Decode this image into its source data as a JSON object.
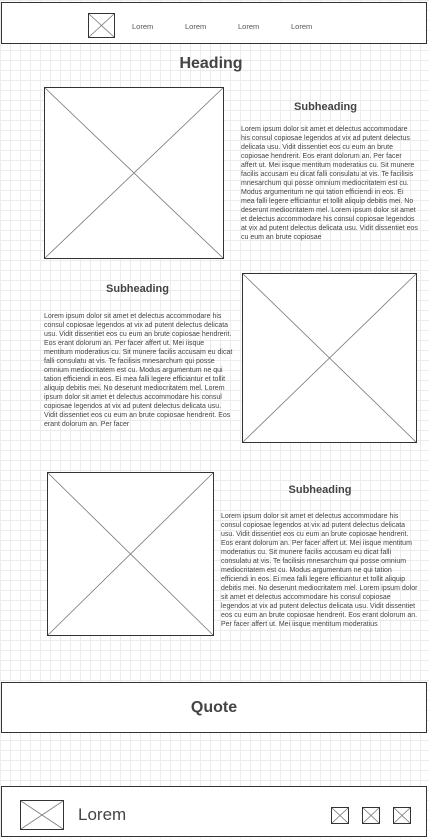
{
  "header": {
    "nav": [
      "Lorem",
      "Lorem",
      "Lorem",
      "Lorem"
    ]
  },
  "main": {
    "heading": "Heading",
    "sections": [
      {
        "subheading": "Subheading",
        "body": "Lorem ipsum dolor sit amet et delectus accommodare his consul copiosae legendos at vix ad putent delectus delicata usu. Vidit dissentiet eos cu eum an brute copiosae hendrerit. Eos erant dolorum an. Per facer affert ut. Mei iisque mentitum moderatius cu. Sit munere facilis accusam eu dicat falli consulatu at vis. Te facilisis mnesarchum qui posse omnium mediocritatem est cu. Modus argumentum ne qui tation efficiendi in eos. Ei mea falli legere efficiantur et tollit aliquip debitis mei. No deserunt mediocritatem mel. Lorem ipsum dolor sit amet et delectus accommodare his consul copiosae legendos at vix ad putent delectus delicata usu. Vidit dissentiet eos cu eum an brute copiosae"
      },
      {
        "subheading": "Subheading",
        "body": "Lorem ipsum dolor sit amet et delectus accommodare his consul copiosae legendos at vix ad putent delectus delicata usu. Vidit dissentiet eos cu eum an brute copiosae hendrerit. Eos erant dolorum an. Per facer affert ut. Mei iisque mentitum moderatius cu. Sit munere facilis accusam eu dicat falli consulatu at vis. Te facilisis mnesarchum qui posse omnium mediocritatem est cu. Modus argumentum ne qui tation efficiendi in eos. Ei mea falli legere efficiantur et tollit aliquip debitis mei. No deserunt mediocritatem mel. Lorem ipsum dolor sit amet et delectus accommodare his consul copiosae legendos at vix ad putent delectus delicata usu. Vidit dissentiet eos cu eum an brute copiosae hendrerit. Eos erant dolorum an. Per facer"
      },
      {
        "subheading": "Subheading",
        "body": "Lorem ipsum dolor sit amet et delectus accommodare his consul copiosae legendos at vix ad putent delectus delicata usu. Vidit dissentiet eos cu eum an brute copiosae hendrerit. Eos erant dolorum an. Per facer affert ut. Mei iisque mentitum moderatius cu. Sit munere facilis accusam eu dicat falli consulatu at vis. Te facilisis mnesarchum qui posse omnium mediocritatem est cu. Modus argumentum ne qui tation efficiendi in eos. Ei mea falli legere efficiantur et tollit aliquip debitis mei. No deserunt mediocritatem mel. Lorem ipsum dolor sit amet et delectus accommodare his consul copiosae legendos at vix ad putent delectus delicata usu. Vidit dissentiet eos cu eum an brute copiosae hendrerit. Eos erant dolorum an. Per facer affert ut. Mei iisque mentitum moderatius"
      }
    ],
    "quote": "Quote"
  },
  "footer": {
    "text": "Lorem"
  }
}
